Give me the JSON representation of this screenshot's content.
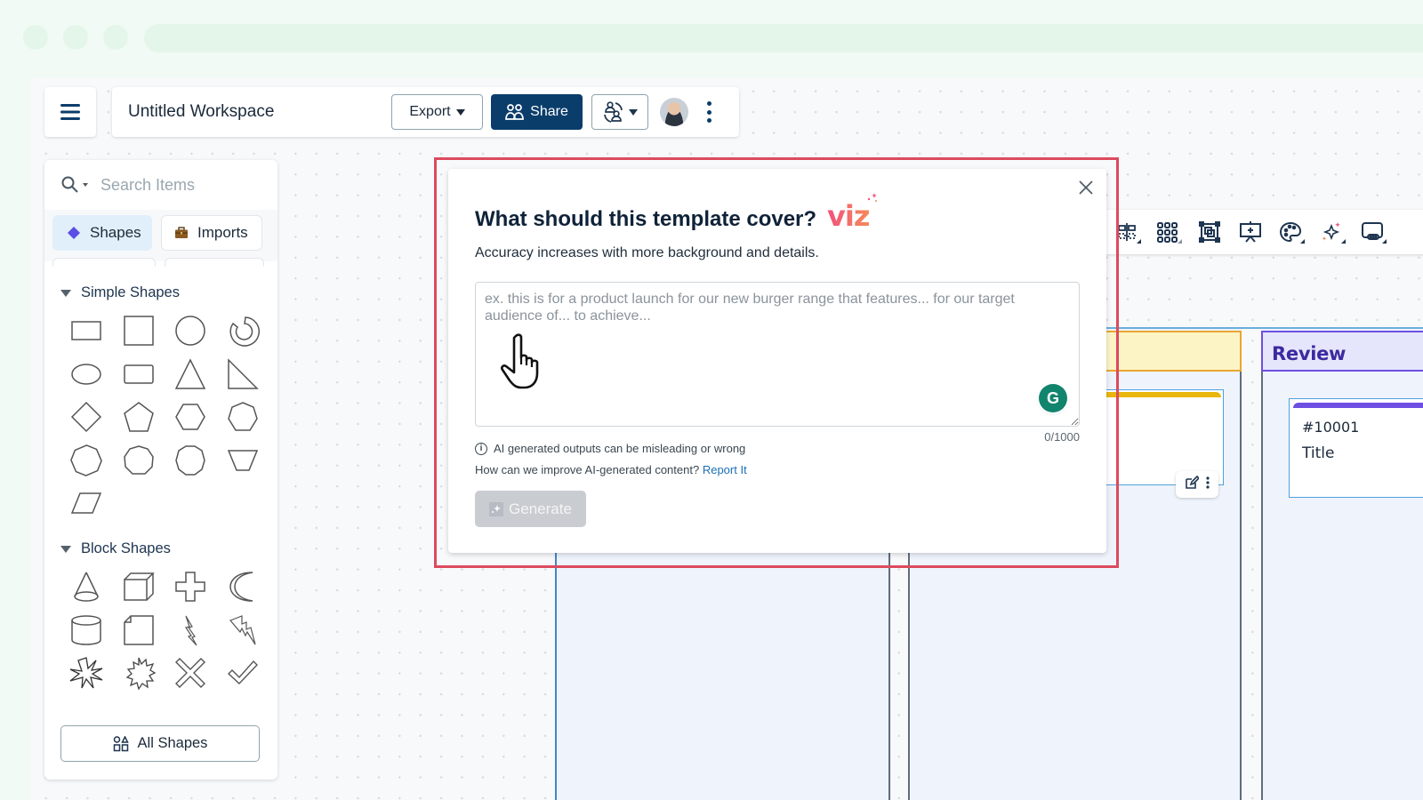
{
  "browser": {
    "dots": 3
  },
  "topbar": {
    "menu_icon": "hamburger-menu-icon",
    "workspace_title": "Untitled Workspace",
    "export_label": "Export",
    "share_label": "Share",
    "share_icon": "users-icon",
    "collab_icon": "user-swap-icon",
    "avatar_icon": "user-avatar",
    "more_icon": "kebab-vertical-icon"
  },
  "sidebar": {
    "search_placeholder": "Search Items",
    "tabs": [
      {
        "label": "Shapes",
        "icon": "diamond-icon",
        "active": true
      },
      {
        "label": "Imports",
        "icon": "briefcase-icon",
        "active": false
      }
    ],
    "sections": [
      {
        "title": "Simple Shapes",
        "shapes": [
          "rectangle",
          "square",
          "circle",
          "circular-arrow",
          "ellipse",
          "rounded-rectangle",
          "triangle",
          "right-triangle",
          "diamond",
          "pentagon",
          "hexagon",
          "heptagon",
          "octagon",
          "nonagon",
          "decagon",
          "inverted-trapezoid",
          "parallelogram"
        ]
      },
      {
        "title": "Block Shapes",
        "shapes": [
          "cone",
          "cube",
          "plus",
          "crescent",
          "cylinder",
          "folded-corner",
          "lightning-bolt",
          "lightning-bolt-alt",
          "explosion",
          "starburst",
          "x-mark",
          "checkmark"
        ]
      }
    ],
    "all_shapes_label": "All Shapes"
  },
  "right_toolbar": {
    "icons": [
      "align-icon",
      "grid-icon",
      "frame-icon",
      "presentation-icon",
      "palette-icon",
      "ai-sparkle-icon",
      "screen-icon"
    ]
  },
  "board": {
    "columns": [
      {
        "title": "",
        "color": "#e8a733"
      },
      {
        "title": "Review",
        "color": "#6d4fe3"
      }
    ],
    "cards": [
      {
        "id": "",
        "title": "",
        "stripe": "#e8b60c"
      },
      {
        "id": "#10001",
        "title": "Title",
        "stripe": "#6d4fe3"
      }
    ]
  },
  "dialog": {
    "title": "What should this template cover?",
    "brand": "viz",
    "subtitle": "Accuracy increases with more background and details.",
    "textarea_value": "",
    "textarea_placeholder": "ex. this is for a product launch for our new burger range that features... for our target audience of... to achieve...",
    "counter": "0/1000",
    "disclaimer": "AI generated outputs can be misleading or wrong",
    "improve_text": "How can we improve AI-generated content?",
    "report_link": "Report It",
    "generate_label": "Generate",
    "grammarly_letter": "G",
    "highlight_color": "#dc4a5e"
  }
}
